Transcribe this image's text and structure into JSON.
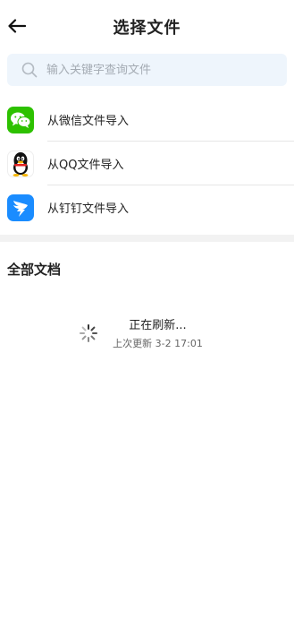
{
  "header": {
    "back_icon": "arrow-left-icon",
    "title": "选择文件"
  },
  "search": {
    "icon": "search-icon",
    "placeholder": "输入关键字查询文件",
    "value": ""
  },
  "import_sources": [
    {
      "icon": "wechat-icon",
      "label": "从微信文件导入",
      "color": "#2dc100"
    },
    {
      "icon": "qq-penguin-icon",
      "label": "从QQ文件导入",
      "color": "#111111"
    },
    {
      "icon": "dingtalk-icon",
      "label": "从钉钉文件导入",
      "color": "#1a8cff"
    }
  ],
  "documents": {
    "section_title": "全部文档",
    "loading_text": "正在刷新...",
    "last_updated": "上次更新 3-2 17:01"
  },
  "colors": {
    "search_bg": "#eef5fc",
    "divider": "#e6e6e6",
    "section_gap": "#f2f2f2"
  }
}
